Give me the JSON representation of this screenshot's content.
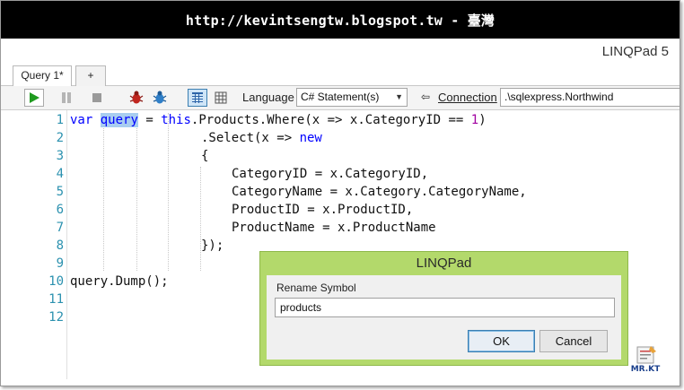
{
  "banner": {
    "text": "http://kevintsengtw.blogspot.tw - 臺灣"
  },
  "app": {
    "title": "LINQPad 5"
  },
  "tabs": [
    {
      "label": "Query 1*"
    },
    {
      "label": "+"
    }
  ],
  "toolbar": {
    "language_label": "Language",
    "language_value": "C# Statement(s)",
    "connection_label": "Connection",
    "connection_value": ".\\sqlexpress.Northwind",
    "icons": [
      "play-icon",
      "pause-icon",
      "stop-icon",
      "bug-red-icon",
      "bug-blue-icon",
      "grid-results-icon",
      "table-results-icon",
      "connection-arrow-icon"
    ]
  },
  "editor": {
    "line_numbers": [
      "1",
      "2",
      "3",
      "4",
      "5",
      "6",
      "7",
      "8",
      "9",
      "10",
      "11",
      "12"
    ],
    "lines": [
      {
        "t1": "var",
        "t2": "query",
        "t3": " = ",
        "t4": "this",
        "t5": ".Products.Where(x => x.CategoryID == ",
        "t6": "1",
        "t7": ")"
      },
      {
        "a": ".Select(x => ",
        "b": "new"
      },
      {
        "a": "{"
      },
      {
        "a": "CategoryID = x.CategoryID,"
      },
      {
        "a": "CategoryName = x.Category.CategoryName,"
      },
      {
        "a": "ProductID = x.ProductID,"
      },
      {
        "a": "ProductName = x.ProductName"
      },
      {
        "a": "});"
      },
      {
        "a": ""
      },
      {
        "a": "query.Dump();"
      },
      {
        "a": ""
      },
      {
        "a": ""
      }
    ]
  },
  "dialog": {
    "title": "LINQPad",
    "label": "Rename Symbol",
    "input_value": "products",
    "ok_label": "OK",
    "cancel_label": "Cancel"
  },
  "watermark": {
    "text": "MR.KT"
  },
  "colors": {
    "keyword": "#0000ff",
    "number": "#a000a0",
    "line_number": "#2b91af",
    "selection": "#a8cdf0",
    "dialog_frame": "#b3d96b"
  }
}
